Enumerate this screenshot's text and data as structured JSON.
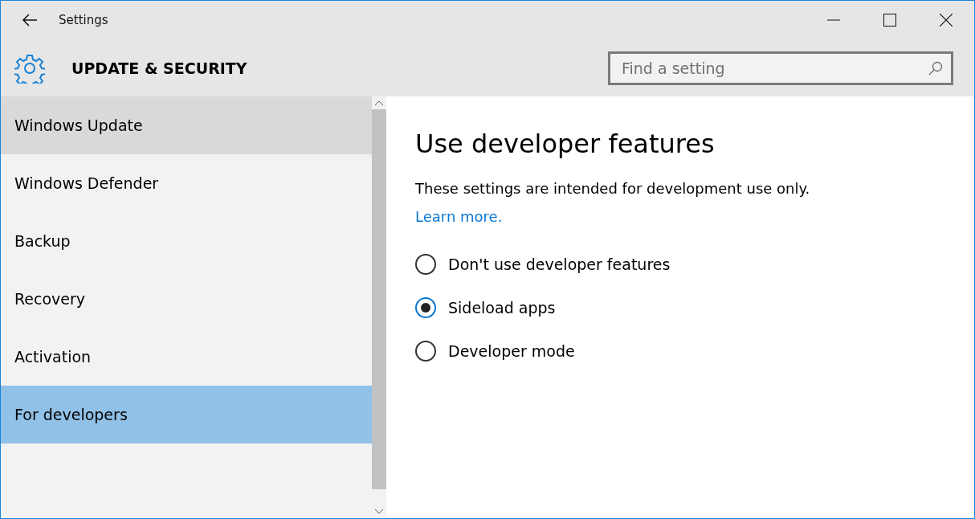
{
  "window": {
    "title": "Settings"
  },
  "header": {
    "title": "UPDATE & SECURITY"
  },
  "search": {
    "placeholder": "Find a setting"
  },
  "sidebar": {
    "items": [
      {
        "label": "Windows Update",
        "selected": false,
        "hovered": true
      },
      {
        "label": "Windows Defender",
        "selected": false,
        "hovered": false
      },
      {
        "label": "Backup",
        "selected": false,
        "hovered": false
      },
      {
        "label": "Recovery",
        "selected": false,
        "hovered": false
      },
      {
        "label": "Activation",
        "selected": false,
        "hovered": false
      },
      {
        "label": "For developers",
        "selected": true,
        "hovered": false
      }
    ]
  },
  "content": {
    "heading": "Use developer features",
    "description": "These settings are intended for development use only.",
    "link": "Learn more.",
    "options": [
      {
        "label": "Don't use developer features",
        "selected": false
      },
      {
        "label": "Sideload apps",
        "selected": true
      },
      {
        "label": "Developer mode",
        "selected": false
      }
    ]
  }
}
